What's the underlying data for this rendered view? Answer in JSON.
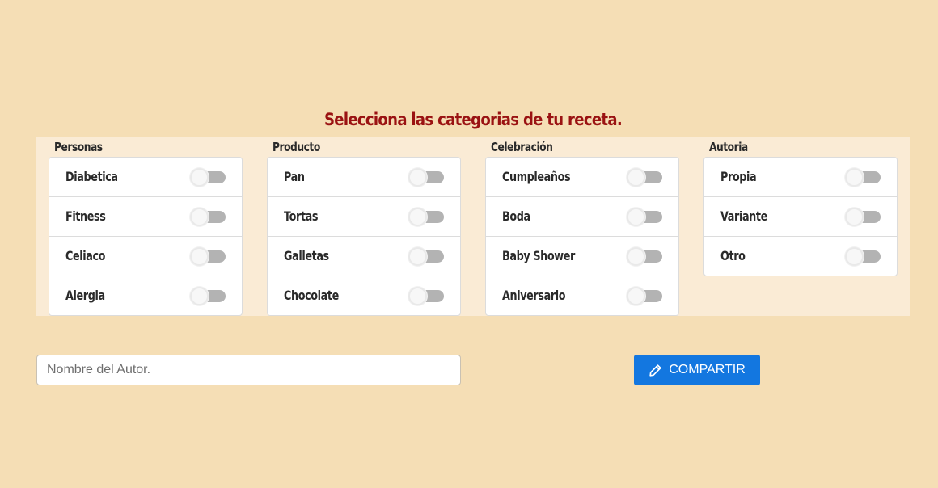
{
  "title": "Selecciona las categorias de tu receta.",
  "groups": [
    {
      "title": "Personas",
      "items": [
        {
          "label": "Diabetica",
          "checked": false
        },
        {
          "label": "Fitness",
          "checked": false
        },
        {
          "label": "Celiaco",
          "checked": false
        },
        {
          "label": "Alergia",
          "checked": false
        }
      ]
    },
    {
      "title": "Producto",
      "items": [
        {
          "label": "Pan",
          "checked": false
        },
        {
          "label": "Tortas",
          "checked": false
        },
        {
          "label": "Galletas",
          "checked": false
        },
        {
          "label": "Chocolate",
          "checked": false
        }
      ]
    },
    {
      "title": "Celebración",
      "items": [
        {
          "label": "Cumpleaños",
          "checked": false
        },
        {
          "label": "Boda",
          "checked": false
        },
        {
          "label": "Baby Shower",
          "checked": false
        },
        {
          "label": "Aniversario",
          "checked": false
        }
      ]
    },
    {
      "title": "Autoria",
      "items": [
        {
          "label": "Propia",
          "checked": false
        },
        {
          "label": "Variante",
          "checked": false
        },
        {
          "label": "Otro",
          "checked": false
        }
      ]
    }
  ],
  "author_field": {
    "placeholder": "Nombre del Autor.",
    "value": ""
  },
  "share_button": {
    "label": "COMPARTIR",
    "icon": "pencil-icon"
  },
  "colors": {
    "background": "#f5deb5",
    "panel": "#faebd5",
    "title": "#9a1212",
    "button": "#1377e0",
    "toggle_off": "#b3b3b3"
  }
}
